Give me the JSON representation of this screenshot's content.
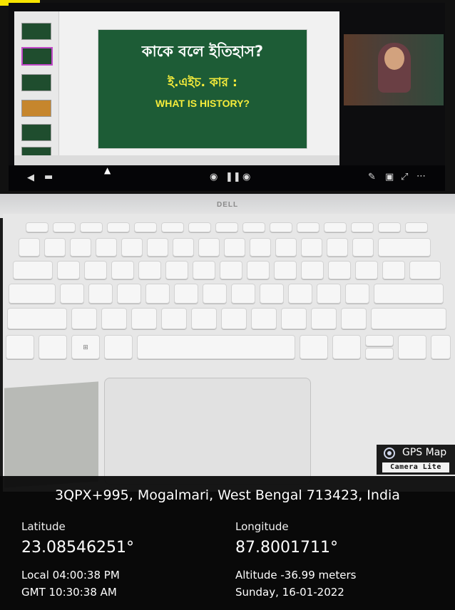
{
  "slide": {
    "title": "কাকে বলে ইতিহাস?",
    "author": "ই.এইচ. কার :",
    "subtitle": "WHAT IS HISTORY?"
  },
  "laptop": {
    "brand": "DELL"
  },
  "gps_badge": {
    "brand": "GPS Map",
    "sub": "Camera Lite"
  },
  "location": {
    "address": "3QPX+995, Mogalmari, West Bengal 713423, India",
    "latitude_label": "Latitude",
    "latitude": "23.08546251°",
    "longitude_label": "Longitude",
    "longitude": "87.8001711°",
    "local_time": "Local 04:00:38 PM",
    "gmt_time": "GMT 10:30:38 AM",
    "altitude": "Altitude -36.99 meters",
    "date": "Sunday, 16-01-2022"
  },
  "colors": {
    "slide_bg": "#1d5c36",
    "slide_accent": "#f5ec3b",
    "overlay_bg": "#080808"
  }
}
